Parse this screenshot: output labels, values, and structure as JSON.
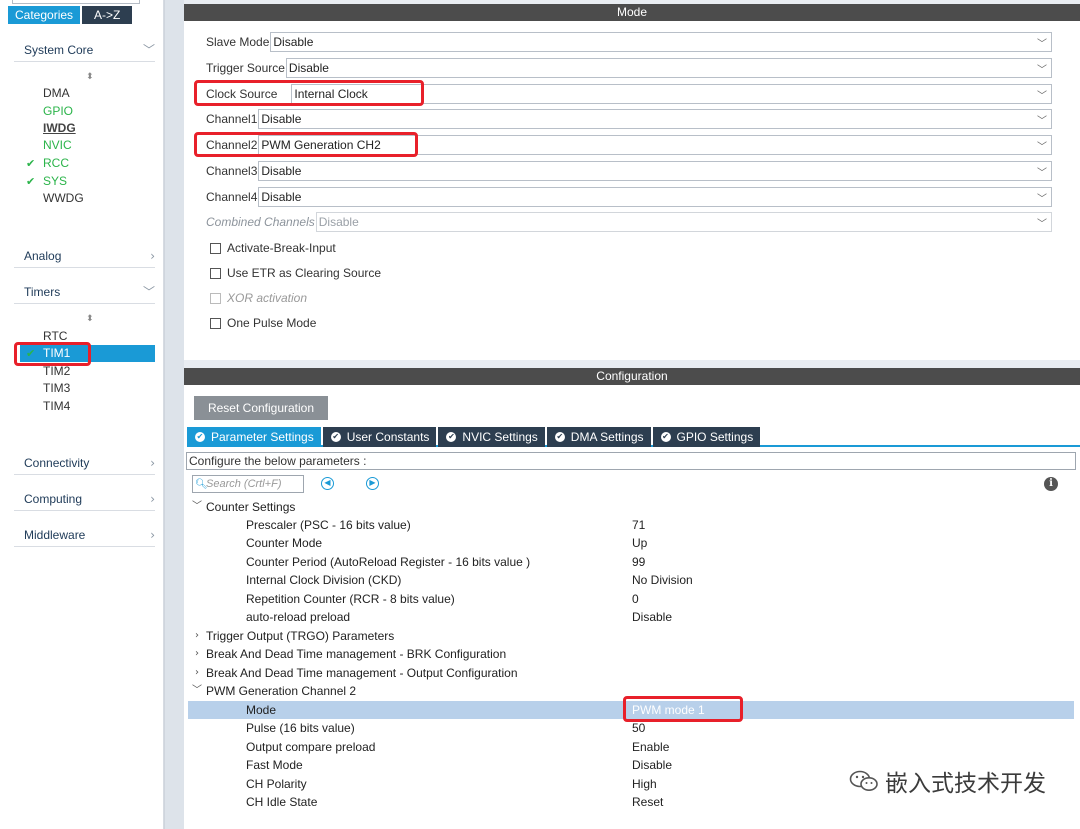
{
  "left": {
    "tabs": {
      "categories": "Categories",
      "az": "A->Z"
    },
    "categories": {
      "system_core": {
        "label": "System Core",
        "items": [
          "DMA",
          "GPIO",
          "IWDG",
          "NVIC",
          "RCC",
          "SYS",
          "WWDG"
        ]
      },
      "analog": {
        "label": "Analog"
      },
      "timers": {
        "label": "Timers",
        "items": [
          "RTC",
          "TIM1",
          "TIM2",
          "TIM3",
          "TIM4"
        ]
      },
      "connectivity": {
        "label": "Connectivity"
      },
      "computing": {
        "label": "Computing"
      },
      "middleware": {
        "label": "Middleware"
      }
    },
    "selected_item": "TIM1"
  },
  "mode": {
    "title": "Mode",
    "fields": [
      {
        "label": "Slave Mode",
        "value": "Disable"
      },
      {
        "label": "Trigger Source",
        "value": "Disable"
      },
      {
        "label": "Clock Source",
        "value": "Internal Clock"
      },
      {
        "label": "Channel1",
        "value": "Disable"
      },
      {
        "label": "Channel2",
        "value": "PWM Generation CH2"
      },
      {
        "label": "Channel3",
        "value": "Disable"
      },
      {
        "label": "Channel4",
        "value": "Disable"
      },
      {
        "label": "Combined Channels",
        "value": "Disable"
      }
    ],
    "checkboxes": [
      {
        "label": "Activate-Break-Input",
        "checked": false
      },
      {
        "label": "Use ETR as Clearing Source",
        "checked": false
      },
      {
        "label": "XOR activation",
        "checked": false
      },
      {
        "label": "One Pulse Mode",
        "checked": false
      }
    ]
  },
  "config": {
    "title": "Configuration",
    "reset_label": "Reset Configuration",
    "tabs": [
      "Parameter Settings",
      "User Constants",
      "NVIC Settings",
      "DMA Settings",
      "GPIO Settings"
    ],
    "configure_text": "Configure the below parameters :",
    "search_placeholder": "Search (Crtl+F)",
    "tree": {
      "counter": {
        "label": "Counter Settings",
        "params": [
          {
            "name": "Prescaler (PSC - 16 bits value)",
            "value": "71"
          },
          {
            "name": "Counter Mode",
            "value": "Up"
          },
          {
            "name": "Counter Period (AutoReload Register - 16 bits value )",
            "value": "99"
          },
          {
            "name": "Internal Clock Division (CKD)",
            "value": "No Division"
          },
          {
            "name": "Repetition Counter (RCR - 8 bits value)",
            "value": "0"
          },
          {
            "name": "auto-reload preload",
            "value": "Disable"
          }
        ]
      },
      "trgo": "Trigger Output (TRGO) Parameters",
      "brk": "Break And Dead Time management - BRK Configuration",
      "output": "Break And Dead Time management - Output Configuration",
      "pwm": {
        "label": "PWM Generation Channel 2",
        "params": [
          {
            "name": "Mode",
            "value": "PWM mode 1"
          },
          {
            "name": "Pulse (16 bits value)",
            "value": "50"
          },
          {
            "name": "Output compare preload",
            "value": "Enable"
          },
          {
            "name": "Fast Mode",
            "value": "Disable"
          },
          {
            "name": "CH Polarity",
            "value": "High"
          },
          {
            "name": "CH Idle State",
            "value": "Reset"
          }
        ]
      }
    }
  },
  "watermark": "嵌入式技术开发",
  "colors": {
    "accent": "#1a9ad6",
    "dark_tab": "#2d3e50",
    "highlight": "#e8202a",
    "ok_green": "#2bb44a"
  }
}
